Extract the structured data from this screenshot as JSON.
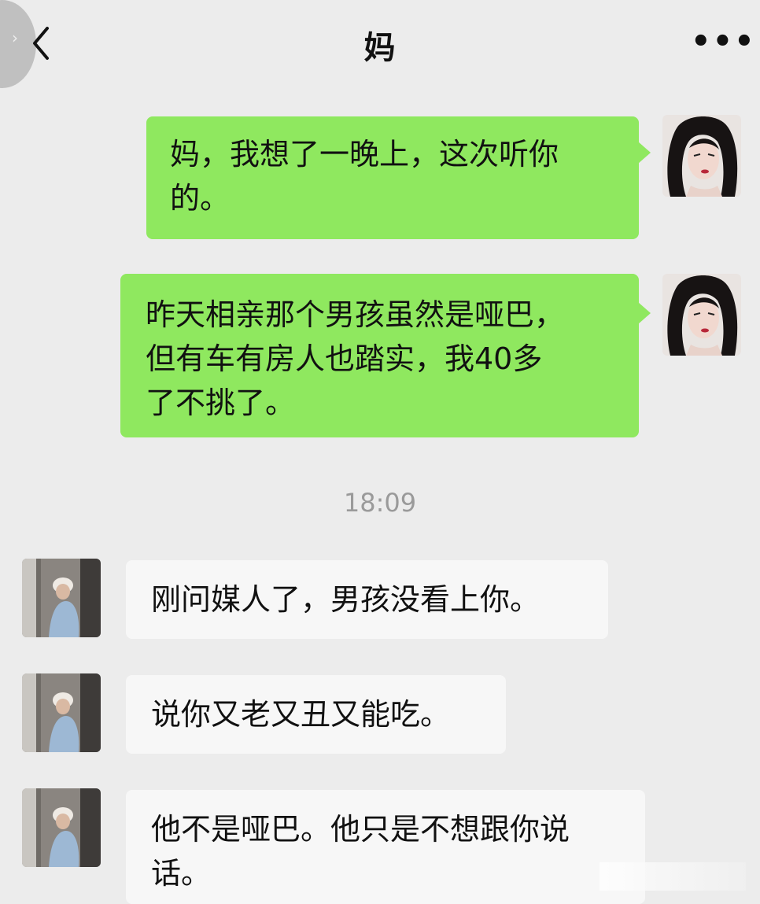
{
  "header": {
    "back_icon": "chevron-left-icon",
    "title": "妈",
    "more_label": "•••"
  },
  "messages": [
    {
      "from": "me",
      "text": "妈，我想了一晚上，这次听你\n的。"
    },
    {
      "from": "me",
      "text": "昨天相亲那个男孩虽然是哑巴，\n但有车有房人也踏实，我40多\n了不挑了。"
    },
    {
      "from": "mom",
      "text": "刚问媒人了，男孩没看上你。"
    },
    {
      "from": "mom",
      "text": "说你又老又丑又能吃。"
    },
    {
      "from": "mom",
      "text": "他不是哑巴。他只是不想跟你说\n话。"
    }
  ],
  "timestamp": "18:09",
  "colors": {
    "background": "#ececec",
    "outgoing_bubble": "#8fe85f",
    "incoming_bubble": "#f7f7f7",
    "timestamp": "#9a9a9a"
  }
}
